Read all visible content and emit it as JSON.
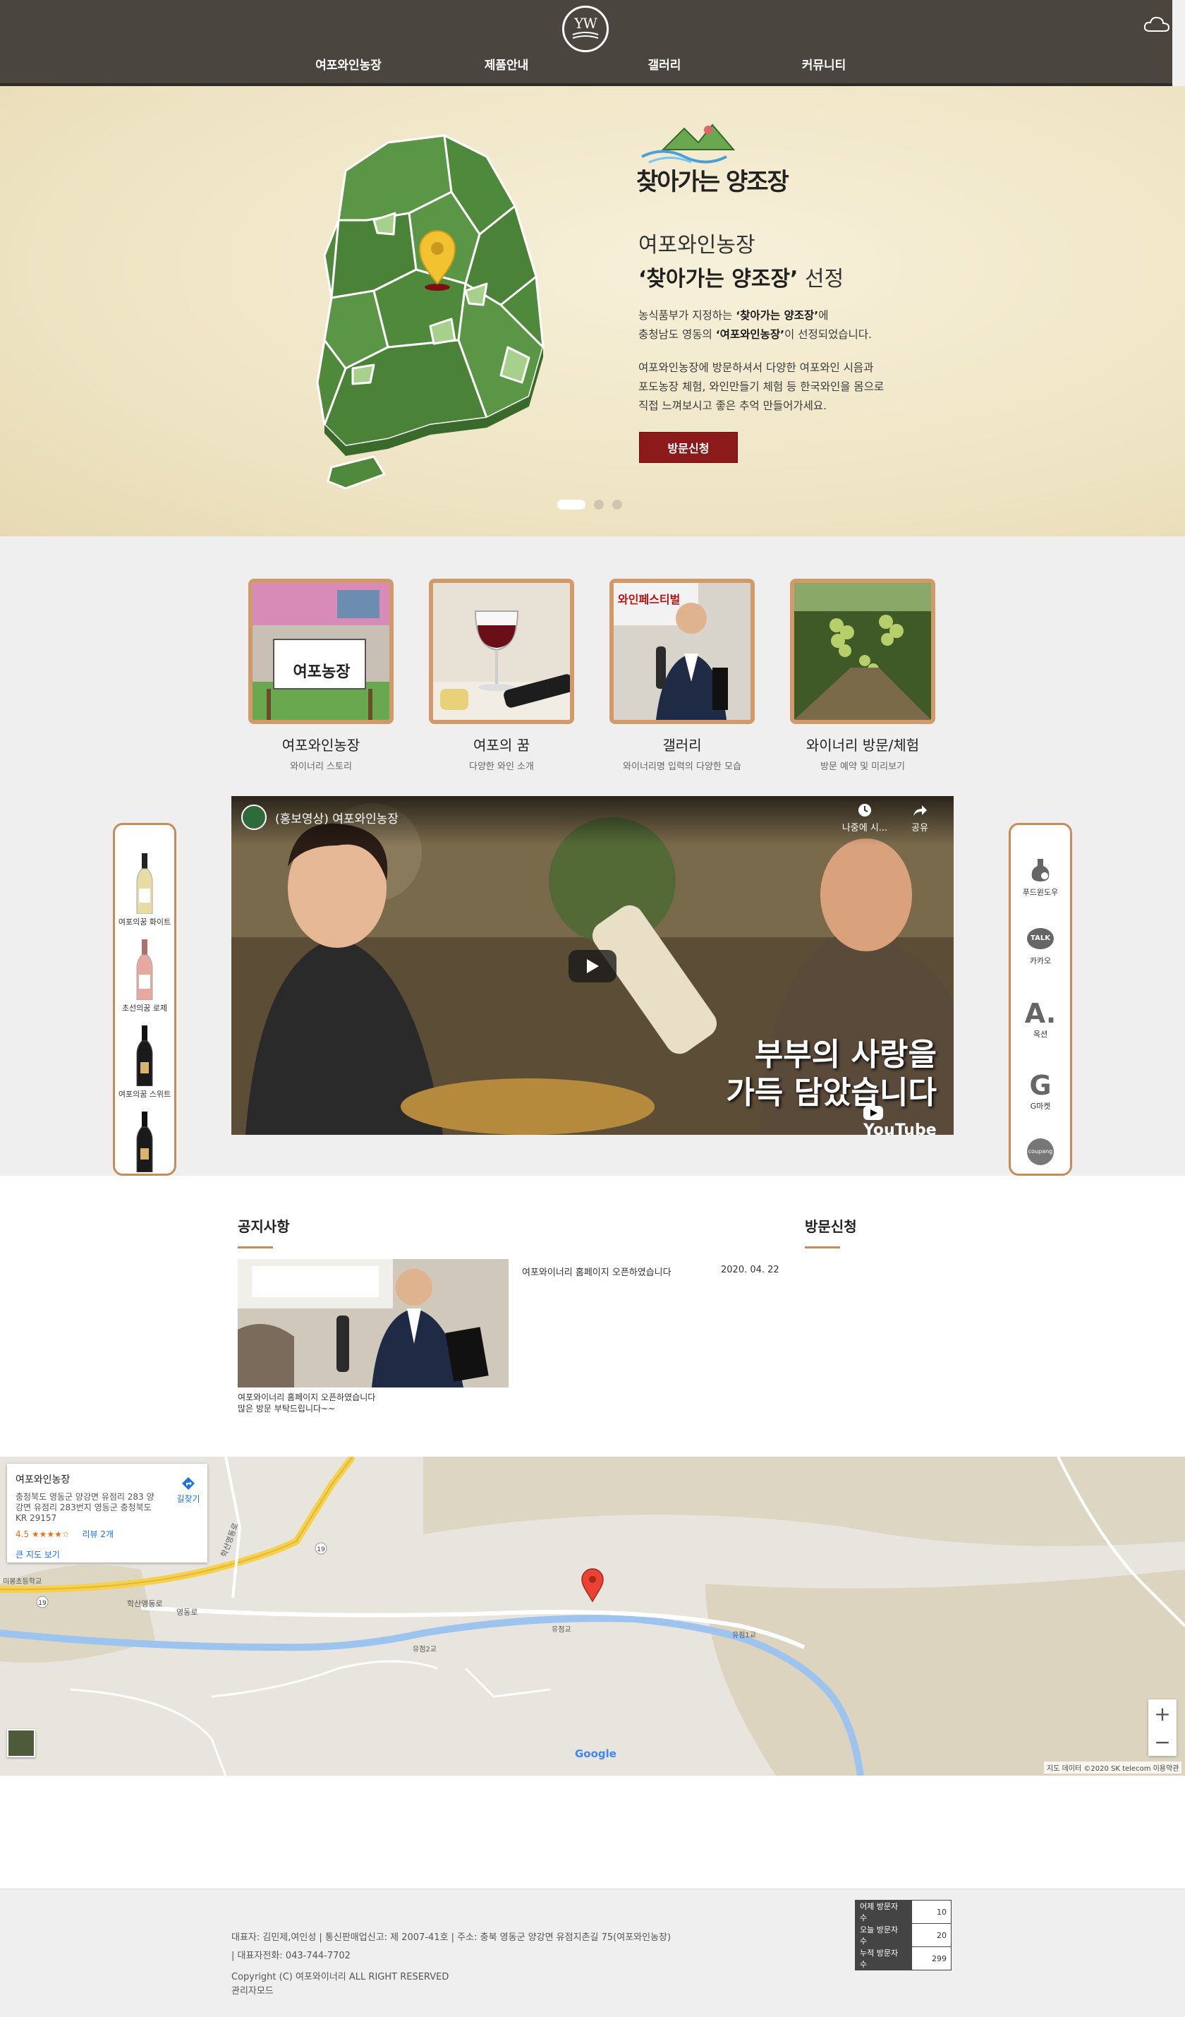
{
  "header": {
    "logo_text": "YW",
    "nav": [
      "여포와인농장",
      "제품안내",
      "갤러리",
      "커뮤니티"
    ]
  },
  "hero": {
    "visit_logo_text": "찾아가는 양조장",
    "title_line1": "여포와인농장",
    "title_line2_bold": "‘찾아가는 양조장’",
    "title_line2_rest": " 선정",
    "para1_a": "농식품부가 지정하는 ",
    "para1_b": "‘찾아가는 양조장’",
    "para1_c": "에",
    "para1_d": "충청남도 영동의 ",
    "para1_e": "‘여포와인농장’",
    "para1_f": "이 선정되었습니다.",
    "para2_l1": "여포와인농장에 방문하셔서 다양한 여포와인 시음과",
    "para2_l2": "포도농장 체험, 와인만들기 체험 등 한국와인을 몸으로",
    "para2_l3": "직접 느껴보시고 좋은 추억 만들어가세요.",
    "button": "방문신청"
  },
  "cards": [
    {
      "title": "여포와인농장",
      "sub": "와이너리 스토리",
      "sign": "여포농장"
    },
    {
      "title": "여포의 꿈",
      "sub": "다양한 와인 소개"
    },
    {
      "title": "갤러리",
      "sub": "와이너리명 입력의 다양한 모습",
      "banner": "와인페스티벌"
    },
    {
      "title": "와이너리 방문/체험",
      "sub": "방문 예약 및 미리보기"
    }
  ],
  "video": {
    "title": "(홍보영상) 여포와인농장",
    "later": "나중에 시...",
    "share": "공유",
    "caption_l1": "부부의 사랑을",
    "caption_l2": "가득 담았습니다",
    "yt": "YouTube"
  },
  "side_left": [
    "여포의꿈 화이트",
    "초선의꿈 로제",
    "여포의꿈 스위트"
  ],
  "side_right": [
    {
      "label": "푸드윈도우",
      "icon": "food-window-icon"
    },
    {
      "label": "카카오",
      "icon": "kakao-talk-icon",
      "glyph": "TALK"
    },
    {
      "label": "옥션",
      "icon": "auction-icon",
      "glyph": "A."
    },
    {
      "label": "G마켓",
      "icon": "gmarket-icon",
      "glyph": "G"
    },
    {
      "label": "",
      "icon": "coupang-icon",
      "glyph": "coupang"
    }
  ],
  "notice": {
    "title": "공지사항",
    "visit_title": "방문신청",
    "caption_l1": "여포와이너리 홈페이지 오픈하였습니다",
    "caption_l2": "많은 방문 부탁드립니다~~",
    "link": "여포와이너리 홈페이지 오픈하였습니다",
    "date": "2020. 04. 22"
  },
  "map": {
    "place": "여포와인농장",
    "addr": "충청북도 영동군 양강면 유점리 283 양강면 유점리 283번지 영동군 충청북도 KR 29157",
    "rating": "4.5 ★★★★☆",
    "review": "리뷰 2개",
    "bigger": "큰 지도 보기",
    "directions": "길찾기",
    "labels": [
      "미봉초등학교",
      "학산영동로",
      "영동로",
      "학산영동로",
      "유점2교",
      "유점교",
      "유점1교"
    ],
    "route_num": "19",
    "google": "Google",
    "attr": "지도 데이터 ©2020 SK telecom   이용약관",
    "zoom_in": "+",
    "zoom_out": "−"
  },
  "footer": {
    "line1": "대표자: 김민제,여인성 | 통신판매업신고: 제 2007-41호 | 주소: 충북 영동군 양강면 유점지촌길 75(여포와인농장)",
    "line2": "| 대표자전화: 043-744-7702",
    "line3": "Copyright (C) 여포와이너리 ALL RIGHT RESERVED",
    "line4": "관리자모드",
    "visitors": [
      {
        "label": "어제 방문자 수",
        "value": "10"
      },
      {
        "label": "오늘 방문자 수",
        "value": "20"
      },
      {
        "label": "누적 방문자 수",
        "value": "299"
      }
    ]
  }
}
